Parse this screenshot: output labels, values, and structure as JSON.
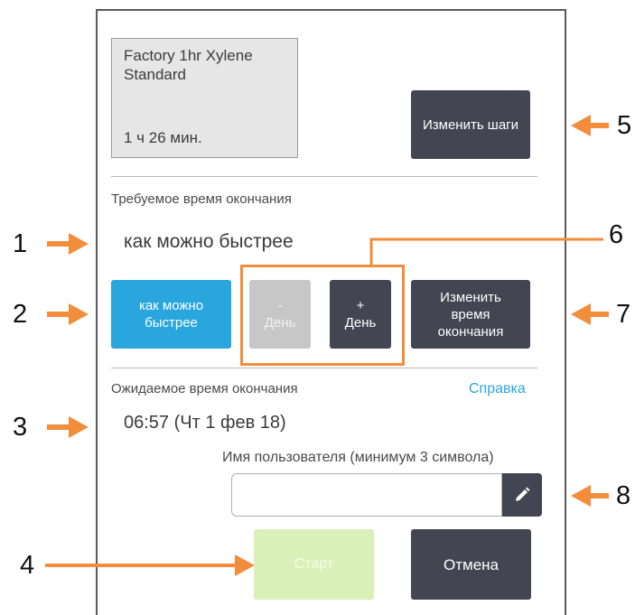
{
  "protocol": {
    "name": "Factory 1hr Xylene Standard",
    "duration": "1 ч 26 мин."
  },
  "buttons": {
    "edit_steps": "Изменить шаги",
    "asap": "как можно быстрее",
    "minus_day_sign": "-",
    "minus_day_label": "День",
    "plus_day_sign": "+",
    "plus_day_label": "День",
    "edit_end_time": "Изменить время окончания",
    "start": "Старт",
    "cancel": "Отмена"
  },
  "required_end": {
    "label": "Требуемое время окончания",
    "value": "как можно быстрее"
  },
  "expected_end": {
    "label": "Ожидаемое время окончания",
    "value": "06:57 (Чт 1 фев 18)",
    "help_link": "Справка"
  },
  "username": {
    "label": "Имя пользователя (минимум 3 символа)",
    "value": "",
    "placeholder": ""
  },
  "callouts": [
    "1",
    "2",
    "3",
    "4",
    "5",
    "6",
    "7",
    "8"
  ],
  "colors": {
    "accent_orange": "#f28d3c",
    "button_dark": "#434652",
    "button_blue": "#29a6dd",
    "button_disabled": "#c7c7c7",
    "start_disabled": "#d9f0b8",
    "link": "#29a6dd"
  },
  "icons": {
    "edit": "pencil-icon",
    "callout_arrow": "arrow-icon"
  }
}
